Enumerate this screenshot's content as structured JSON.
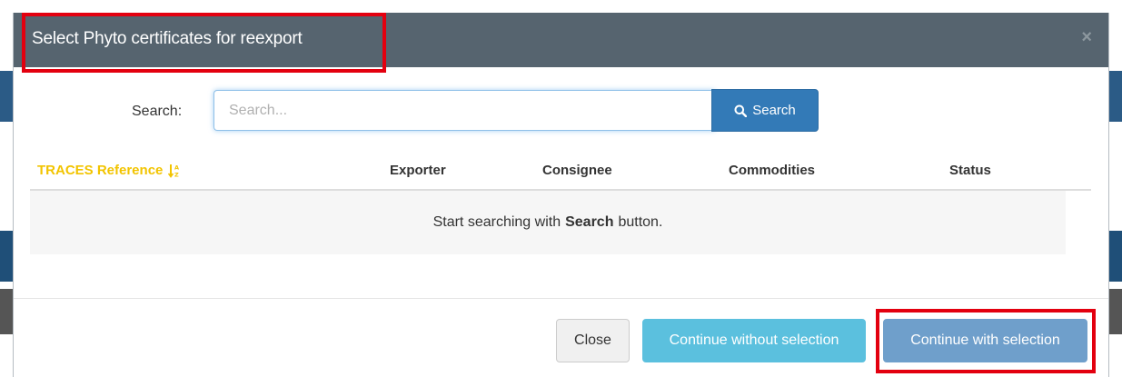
{
  "dialog": {
    "title": "Select Phyto certificates for reexport",
    "close_glyph": "×"
  },
  "search": {
    "label": "Search:",
    "placeholder": "Search...",
    "value": "",
    "button_icon": "search-icon",
    "button_label": "Search"
  },
  "table": {
    "columns": [
      {
        "label": "TRACES Reference",
        "sort_icon": "sort-alpha-asc-icon",
        "active": true
      },
      {
        "label": "Exporter"
      },
      {
        "label": "Consignee"
      },
      {
        "label": "Commodities"
      },
      {
        "label": "Status"
      }
    ],
    "empty_message": {
      "before": "Start searching with",
      "emphasis": "Search",
      "after": "button."
    }
  },
  "footer": {
    "close_label": "Close",
    "continue_without_label": "Continue without selection",
    "continue_with_label": "Continue with selection"
  },
  "colors": {
    "header_bg": "#56646f",
    "active_column": "#f2c400",
    "primary": "#337ab7",
    "info": "#5bc0de",
    "annotation": "#e3000f"
  }
}
